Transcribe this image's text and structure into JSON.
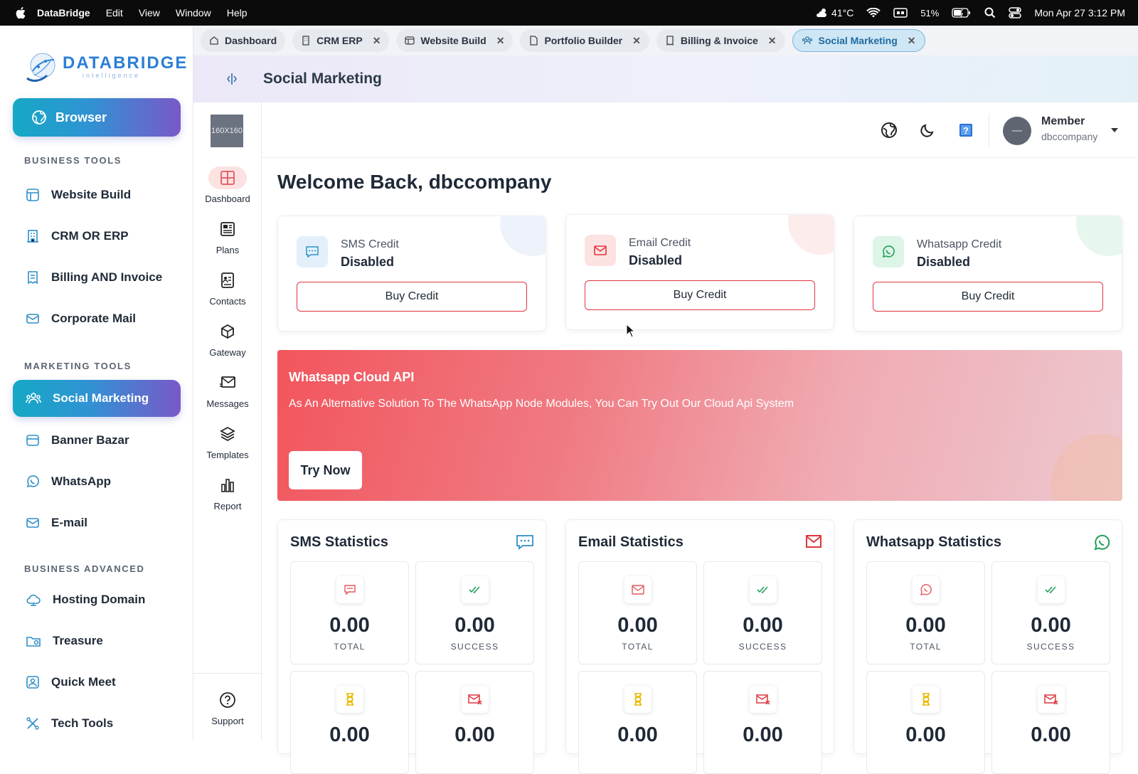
{
  "menubar": {
    "app_name": "DataBridge",
    "menus": [
      "Edit",
      "View",
      "Window",
      "Help"
    ],
    "weather": "41°C",
    "battery": "51%",
    "datetime": "Mon Apr 27  3:12 PM"
  },
  "sidebar": {
    "logo_text": "DATABRIDGE",
    "logo_sub": "intelligence",
    "browser_label": "Browser",
    "sections": {
      "business_tools": "BUSINESS TOOLS",
      "marketing_tools": "MARKETING TOOLS",
      "business_advanced": "BUSINESS ADVANCED"
    },
    "items": {
      "website_build": "Website Build",
      "crm": "CRM OR ERP",
      "billing": "Billing AND  Invoice",
      "corporate_mail": "Corporate Mail",
      "social_marketing": "Social Marketing",
      "banner_bazar": "Banner Bazar",
      "whatsapp": "WhatsApp",
      "email": "E-mail",
      "hosting": "Hosting Domain",
      "treasure": "Treasure",
      "quick_meet": "Quick Meet",
      "tech_tools": "Tech Tools"
    }
  },
  "tabs": [
    "Dashboard",
    "CRM ERP",
    "Website Build",
    "Portfolio Builder",
    "Billing & Invoice",
    "Social Marketing"
  ],
  "header": {
    "title": "Social Marketing"
  },
  "rail": {
    "placeholder": "160X160",
    "items": [
      "Dashboard",
      "Plans",
      "Contacts",
      "Gateway",
      "Messages",
      "Templates",
      "Report"
    ],
    "support": "Support"
  },
  "topbar": {
    "user_role": "Member",
    "user_company": "dbccompany"
  },
  "main": {
    "welcome": "Welcome Back, dbccompany",
    "credits": [
      {
        "label": "SMS Credit",
        "status": "Disabled",
        "button": "Buy Credit"
      },
      {
        "label": "Email Credit",
        "status": "Disabled",
        "button": "Buy Credit"
      },
      {
        "label": "Whatsapp Credit",
        "status": "Disabled",
        "button": "Buy Credit"
      }
    ],
    "banner": {
      "title": "Whatsapp Cloud API",
      "desc": "As An Alternative Solution To The WhatsApp Node Modules, You Can Try Out Our Cloud Api System",
      "button": "Try Now"
    },
    "stats": [
      {
        "title": "SMS Statistics",
        "total": "0.00",
        "success": "0.00",
        "pending": "0.00",
        "failed": "0.00"
      },
      {
        "title": "Email Statistics",
        "total": "0.00",
        "success": "0.00",
        "pending": "0.00",
        "failed": "0.00"
      },
      {
        "title": "Whatsapp Statistics",
        "total": "0.00",
        "success": "0.00",
        "pending": "0.00",
        "failed": "0.00"
      }
    ],
    "stat_labels": {
      "total": "TOTAL",
      "success": "SUCCESS"
    }
  },
  "colors": {
    "accent_gradient_start": "#15a8c5",
    "accent_gradient_end": "#7a58c8",
    "danger": "#e0363f",
    "rail_active": "#fde2e2"
  }
}
